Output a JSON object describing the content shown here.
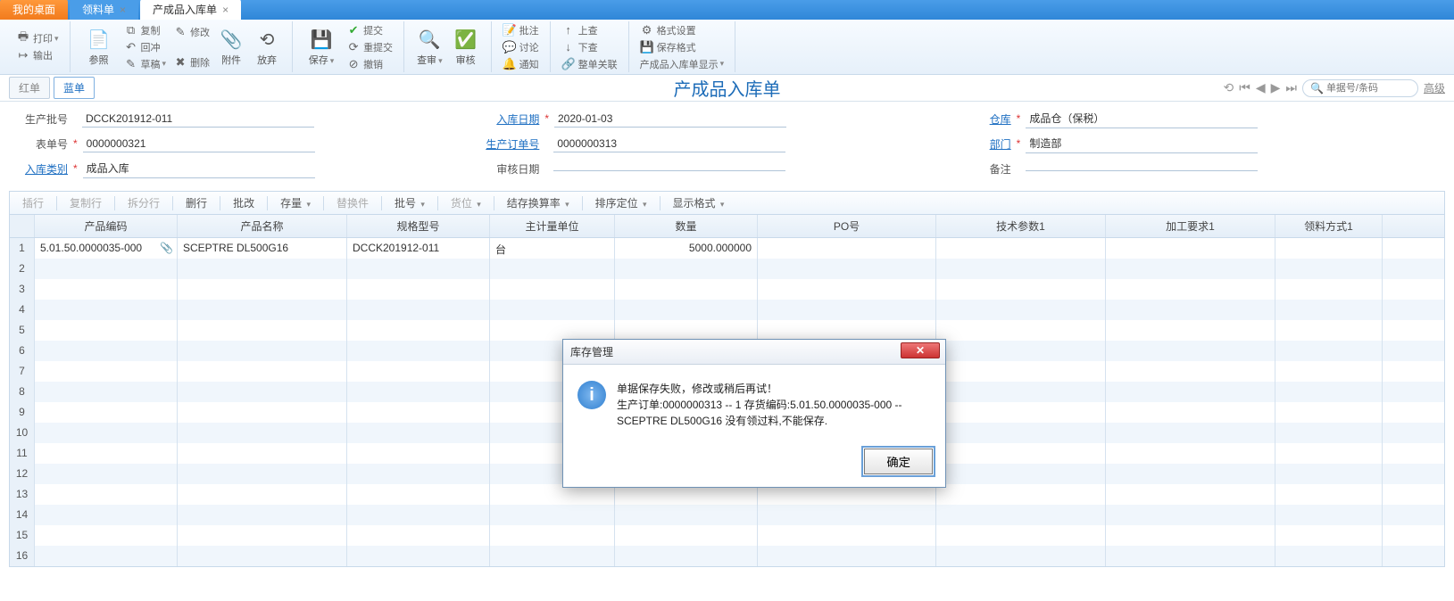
{
  "tabs": [
    {
      "label": "我的桌面",
      "cls": "orange"
    },
    {
      "label": "领料单",
      "cls": "blue",
      "close": true
    },
    {
      "label": "产成品入库单",
      "cls": "active",
      "close": true
    }
  ],
  "ribbon": {
    "print": "打印",
    "out": "输出",
    "ref": "参照",
    "copy": "复制",
    "back": "回冲",
    "draft": "草稿",
    "edit": "修改",
    "del": "删除",
    "attach": "附件",
    "abandon": "放弃",
    "save": "保存",
    "submit": "提交",
    "resubmit": "重提交",
    "revoke": "撤销",
    "review": "查审",
    "audit": "审核",
    "batch_review": "批注",
    "discuss": "讨论",
    "notify": "通知",
    "up": "上查",
    "down": "下查",
    "bill_rel": "整单关联",
    "fmt": "格式设置",
    "save_fmt": "保存格式",
    "display": "产成品入库单显示"
  },
  "docheader": {
    "red": "红单",
    "blue": "蓝单",
    "title": "产成品入库单",
    "search_ph": "单据号/条码",
    "advanced": "高级"
  },
  "form": {
    "labels": {
      "prod_batch": "生产批号",
      "form_no": "表单号",
      "in_type": "入库类别",
      "in_date": "入库日期",
      "prod_order": "生产订单号",
      "audit_date": "审核日期",
      "wh": "仓库",
      "dept": "部门",
      "remark": "备注"
    },
    "values": {
      "prod_batch": "DCCK201912-011",
      "form_no": "0000000321",
      "in_type": "成品入库",
      "in_date": "2020-01-03",
      "prod_order": "0000000313",
      "audit_date": "",
      "wh": "成品仓（保税）",
      "dept": "制造部",
      "remark": ""
    }
  },
  "gridToolbar": {
    "insert": "插行",
    "copy": "复制行",
    "split": "拆分行",
    "delrow": "删行",
    "batch_edit": "批改",
    "stock": "存量",
    "replace": "替换件",
    "batch": "批号",
    "loc": "货位",
    "conv": "结存换算率",
    "sort": "排序定位",
    "dispfmt": "显示格式"
  },
  "gridHeaders": {
    "code": "产品编码",
    "name": "产品名称",
    "spec": "规格型号",
    "unit": "主计量单位",
    "qty": "数量",
    "po": "PO号",
    "tech": "技术参数1",
    "proc": "加工要求1",
    "mat": "领料方式1"
  },
  "rows": [
    {
      "code": "5.01.50.0000035-000",
      "name": "SCEPTRE DL500G16",
      "spec": "DCCK201912-011",
      "unit": "台",
      "qty": "5000.000000",
      "po": "",
      "tech": "",
      "proc": "",
      "mat": ""
    }
  ],
  "dialog": {
    "title": "库存管理",
    "line1": "单据保存失败，修改或稍后再试！",
    "line2": "生产订单:0000000313 -- 1 存货编码:5.01.50.0000035-000 -- SCEPTRE DL500G16 没有领过料,不能保存.",
    "ok": "确定"
  }
}
